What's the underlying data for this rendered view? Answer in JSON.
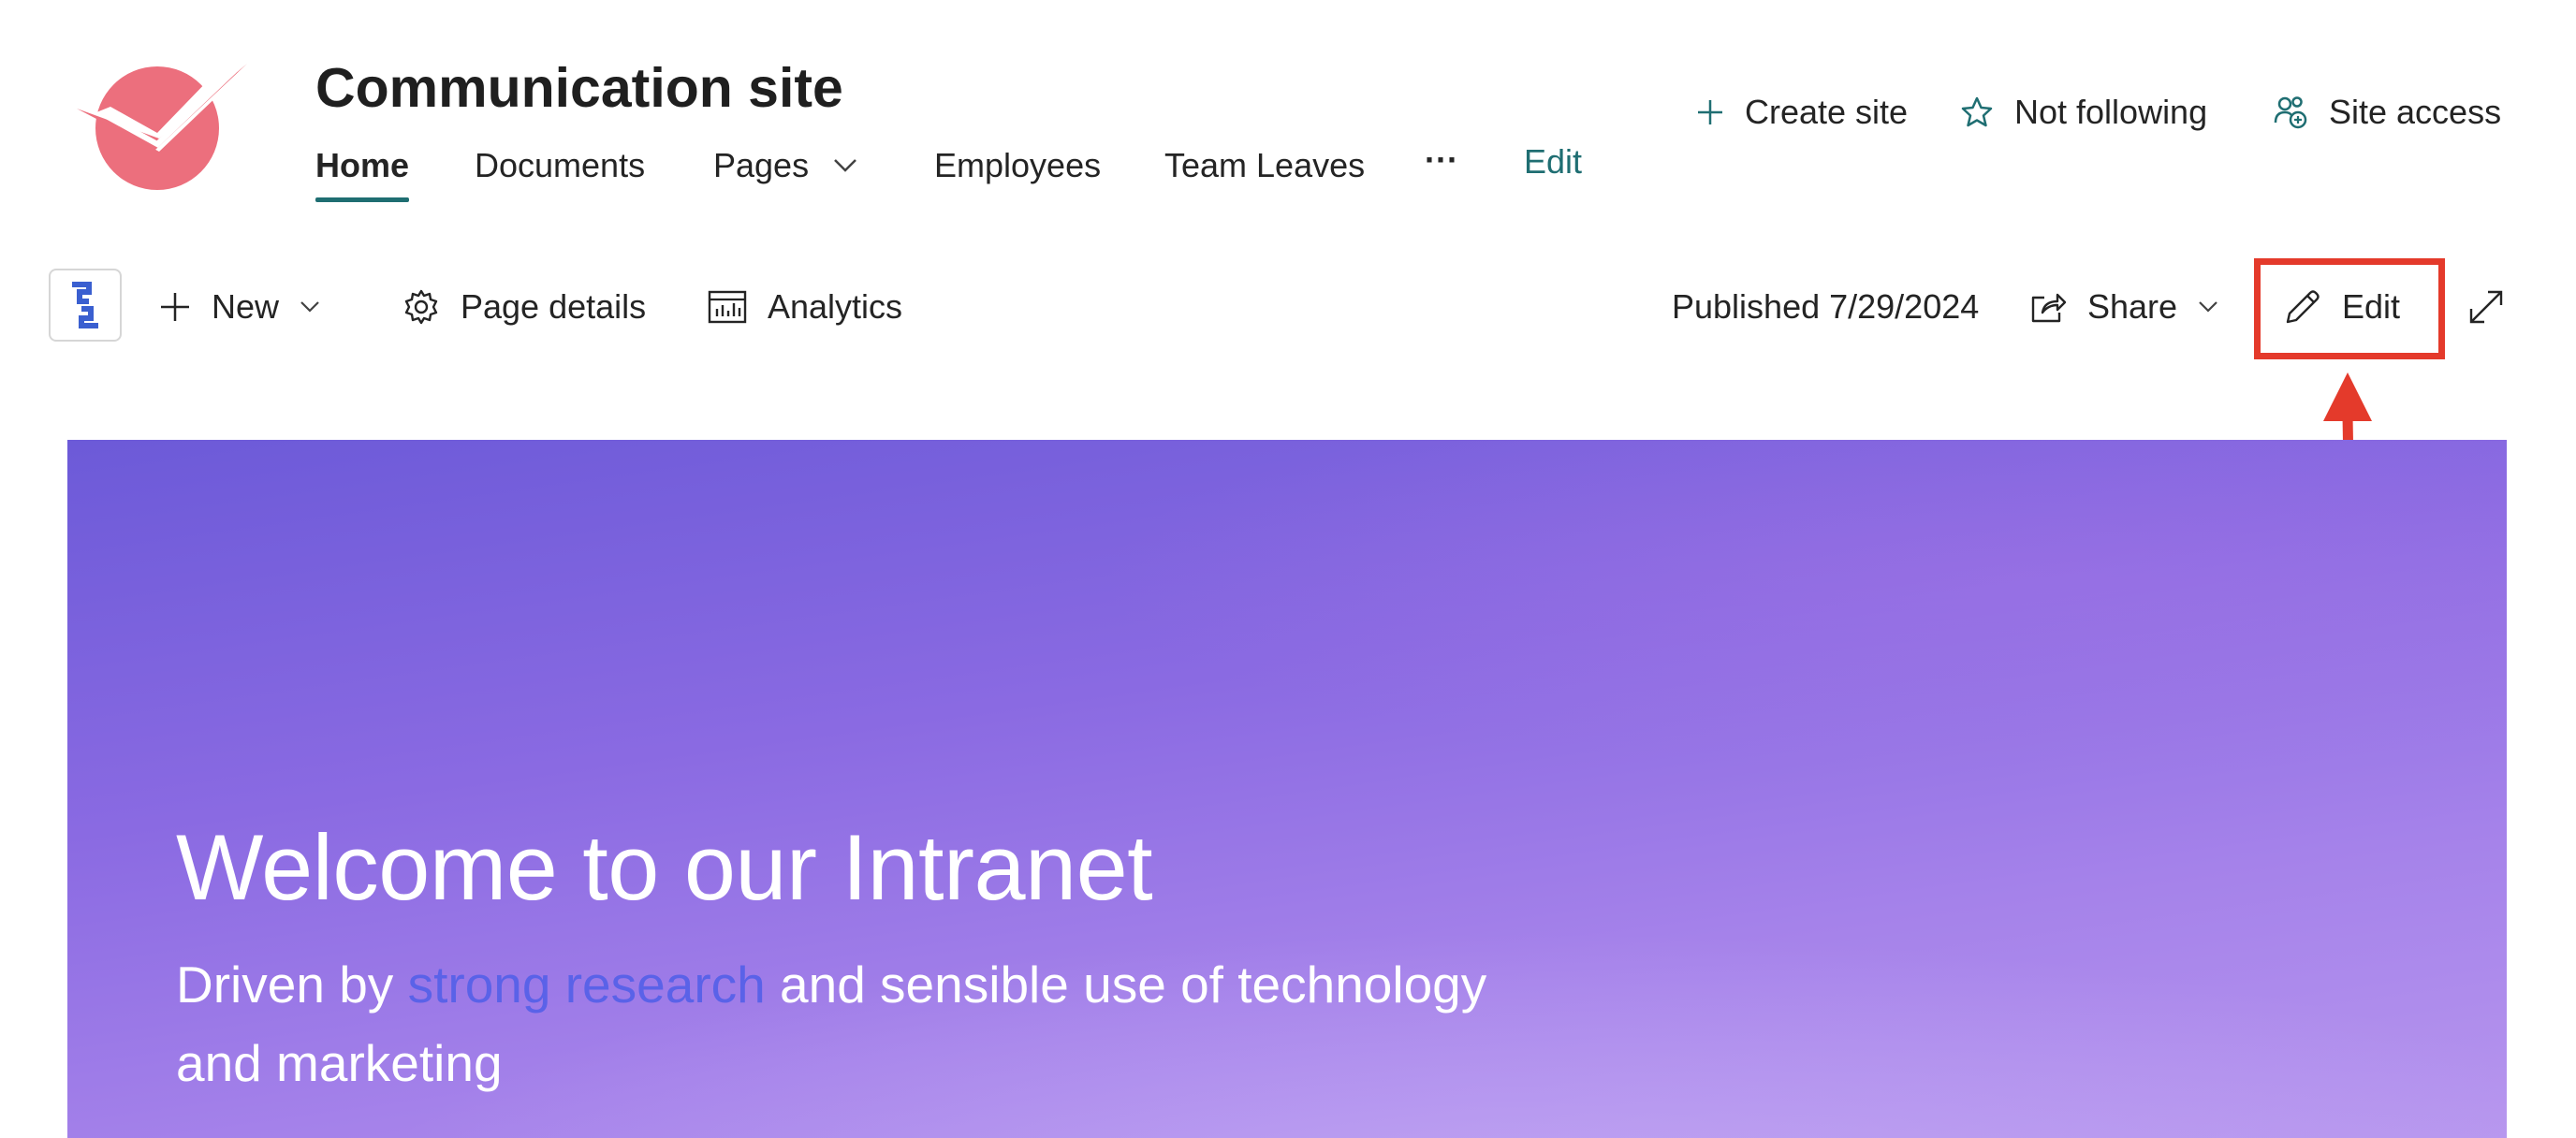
{
  "site": {
    "title": "Communication site",
    "logo_icon": "site-logo-checkmark-icon",
    "brand_color": "#e8707c"
  },
  "nav": {
    "items": [
      {
        "label": "Home",
        "active": true
      },
      {
        "label": "Documents"
      },
      {
        "label": "Pages",
        "has_dropdown": true
      },
      {
        "label": "Employees"
      },
      {
        "label": "Team Leaves"
      }
    ],
    "more_label": "···",
    "edit_label": "Edit",
    "accent_color": "#1f6e72"
  },
  "header_actions": {
    "create_site": "Create site",
    "follow": "Not following",
    "site_access": "Site access"
  },
  "command_bar": {
    "new_label": "New",
    "page_details_label": "Page details",
    "analytics_label": "Analytics",
    "published": "Published 7/29/2024",
    "share_label": "Share",
    "edit_label": "Edit"
  },
  "annotation": {
    "highlight_color": "#e43a2b"
  },
  "hero": {
    "title": "Welcome to our Intranet",
    "subtitle_before": "Driven by ",
    "subtitle_link": "strong research",
    "subtitle_after": " and sensible use of technology and marketing",
    "gradient_top": "#6c5ad8",
    "gradient_bottom": "#b695ee"
  }
}
